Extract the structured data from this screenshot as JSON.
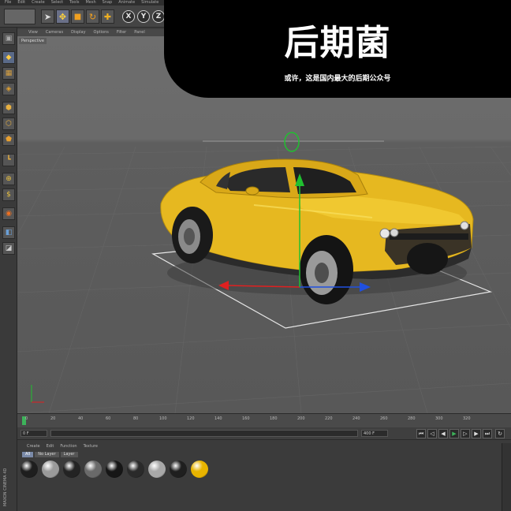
{
  "menubar": {
    "items": [
      "File",
      "Edit",
      "Create",
      "Select",
      "Tools",
      "Mesh",
      "Snap",
      "Animate",
      "Simulate"
    ]
  },
  "toolbar": {
    "axes": [
      "X",
      "Y",
      "Z"
    ]
  },
  "viewport": {
    "menu": [
      "View",
      "Cameras",
      "Display",
      "Options",
      "Filter",
      "Panel"
    ],
    "label": "Perspective"
  },
  "banner": {
    "title": "后期菌",
    "subtitle": "或许，这是国内最大的后期公众号"
  },
  "timeline": {
    "ticks": [
      "0",
      "20",
      "40",
      "60",
      "80",
      "100",
      "120",
      "140",
      "160",
      "180",
      "200",
      "220",
      "240",
      "260",
      "280",
      "300",
      "320"
    ],
    "start_field": "0 F",
    "end_field": "400 F"
  },
  "materials": {
    "menu": [
      "Create",
      "Edit",
      "Function",
      "Texture"
    ],
    "tabs": [
      "All",
      "No Layer",
      "Layer"
    ],
    "balls": [
      {
        "color": "#1e1e1e"
      },
      {
        "color": "#9a9a9a"
      },
      {
        "color": "#232323"
      },
      {
        "color": "#6a6a6a"
      },
      {
        "color": "#161616"
      },
      {
        "color": "#2a2a2a"
      },
      {
        "color": "#a8a8a8"
      },
      {
        "color": "#1f1f1f"
      },
      {
        "color": "#e8b400"
      }
    ]
  },
  "side_brand": "MAXON CINEMA 4D",
  "colors": {
    "car": "#e6b820",
    "axis_x": "#e02020",
    "axis_y": "#20c030",
    "axis_z": "#2050e0"
  }
}
